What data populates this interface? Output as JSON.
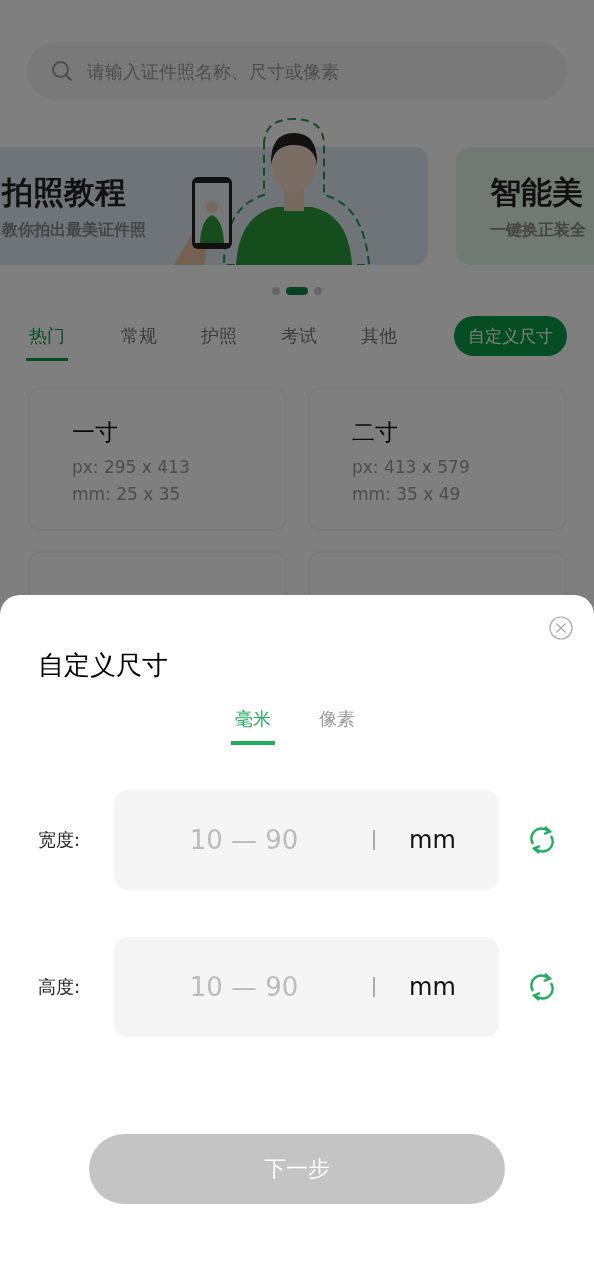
{
  "search": {
    "placeholder": "请输入证件照名称、尺寸或像素"
  },
  "banners": [
    {
      "title": "拍照教程",
      "subtitle": "教你拍出最美证件照",
      "kind": "picture"
    },
    {
      "title": "智能美",
      "subtitle": "一键换正装全"
    }
  ],
  "carousel_dots": [
    {
      "selected": false
    },
    {
      "selected": true
    },
    {
      "selected": false
    }
  ],
  "category_tabs": [
    {
      "label": "热门",
      "selected": true
    },
    {
      "label": "常规",
      "selected": false
    },
    {
      "label": "护照",
      "selected": false
    },
    {
      "label": "考试",
      "selected": false
    },
    {
      "label": "其他",
      "selected": false
    }
  ],
  "custom_size_button": "自定义尺寸",
  "size_cards": [
    {
      "title": "一寸",
      "px": "px: 295 x 413",
      "mm": "mm: 25 x 35"
    },
    {
      "title": "二寸",
      "px": "px: 413 x 579",
      "mm": "mm: 35 x 49"
    }
  ],
  "dialog": {
    "title": "自定义尺寸",
    "unit_tabs": [
      {
        "label": "毫米",
        "selected": true
      },
      {
        "label": "像素",
        "selected": false
      }
    ],
    "fields": [
      {
        "label": "宽度:",
        "placeholder": "10 — 90",
        "unit": "mm"
      },
      {
        "label": "高度:",
        "placeholder": "10 — 90",
        "unit": "mm"
      }
    ],
    "next_button": {
      "label": "下一步",
      "disabled": true
    }
  }
}
